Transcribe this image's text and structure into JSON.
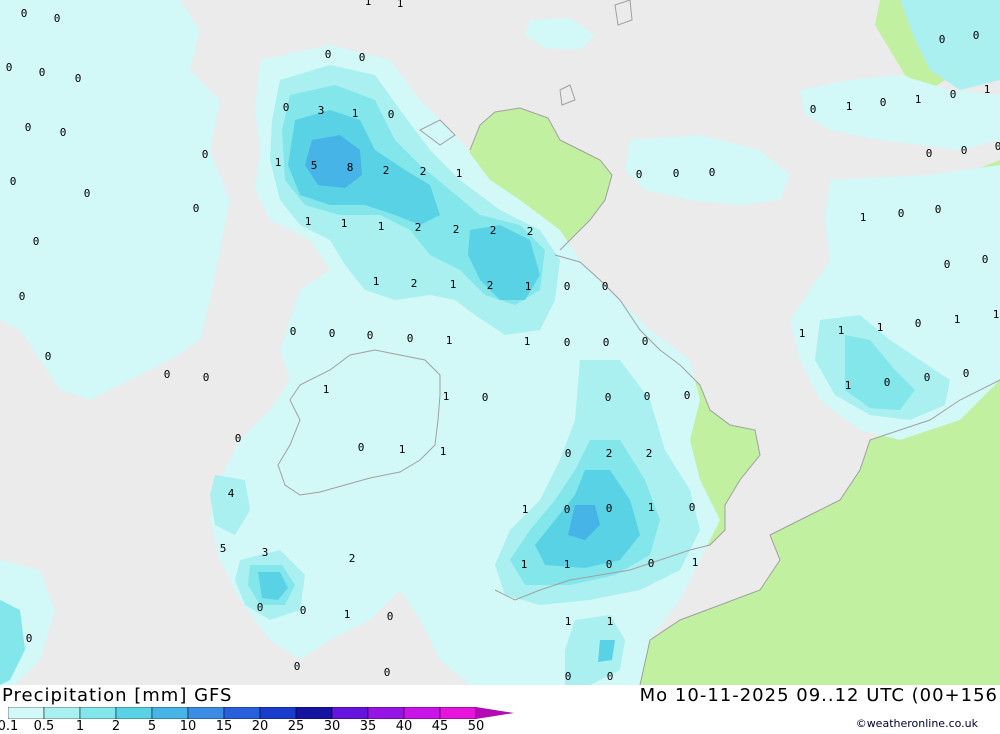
{
  "header": {
    "title_left": "Precipitation [mm] GFS",
    "title_right": "Mo 10-11-2025 09..12 UTC (00+156"
  },
  "credit": "©weatheronline.co.uk",
  "legend": {
    "levels": [
      "0.1",
      "0.5",
      "1",
      "2",
      "5",
      "10",
      "15",
      "20",
      "25",
      "30",
      "35",
      "40",
      "45",
      "50"
    ],
    "colors": [
      "#d2f8f8",
      "#aaf0f0",
      "#82e6ea",
      "#5ad2e6",
      "#46b4e6",
      "#3c8ce6",
      "#2860dc",
      "#1a3ccc",
      "#1414a0",
      "#6414dc",
      "#9614e6",
      "#c814e6",
      "#e614dc",
      "#b40ab4"
    ]
  },
  "palette": {
    "sea": "#ebebeb",
    "land": "#c0f0a0",
    "precip_light": "#d2f8f8",
    "precip_mid": "#aaf0f0",
    "precip_1": "#82e6ea",
    "precip_2": "#5ad2e6",
    "precip_5": "#46b4e6"
  },
  "map_values": [
    {
      "v": "0"
    },
    {
      "v": "0"
    },
    {
      "v": "0"
    },
    {
      "v": "0"
    },
    {
      "v": "0"
    },
    {
      "v": "0"
    },
    {
      "v": "0"
    },
    {
      "v": "0"
    },
    {
      "v": "0"
    },
    {
      "v": "0"
    },
    {
      "v": "0"
    },
    {
      "v": "0"
    },
    {
      "v": "0"
    },
    {
      "v": "0"
    },
    {
      "v": "0"
    },
    {
      "v": "0"
    },
    {
      "v": "0"
    },
    {
      "v": "3"
    },
    {
      "v": "1"
    },
    {
      "v": "0"
    },
    {
      "v": "1"
    },
    {
      "v": "5"
    },
    {
      "v": "8"
    },
    {
      "v": "2"
    },
    {
      "v": "2"
    },
    {
      "v": "1"
    },
    {
      "v": "1"
    },
    {
      "v": "1"
    },
    {
      "v": "1"
    },
    {
      "v": "2"
    },
    {
      "v": "2"
    },
    {
      "v": "2"
    },
    {
      "v": "2"
    },
    {
      "v": "1"
    },
    {
      "v": "2"
    },
    {
      "v": "1"
    },
    {
      "v": "2"
    },
    {
      "v": "1"
    },
    {
      "v": "0"
    },
    {
      "v": "0"
    },
    {
      "v": "0"
    },
    {
      "v": "0"
    },
    {
      "v": "0"
    },
    {
      "v": "0"
    },
    {
      "v": "0"
    },
    {
      "v": "0"
    },
    {
      "v": "0"
    },
    {
      "v": "1"
    },
    {
      "v": "1"
    },
    {
      "v": "0"
    },
    {
      "v": "0"
    },
    {
      "v": "0"
    },
    {
      "v": "0"
    },
    {
      "v": "0"
    },
    {
      "v": "1"
    },
    {
      "v": "1"
    },
    {
      "v": "0"
    },
    {
      "v": "0"
    },
    {
      "v": "0"
    },
    {
      "v": "0"
    },
    {
      "v": "0"
    },
    {
      "v": "0"
    },
    {
      "v": "1"
    },
    {
      "v": "1"
    },
    {
      "v": "0"
    },
    {
      "v": "2"
    },
    {
      "v": "2"
    },
    {
      "v": "4"
    },
    {
      "v": "1"
    },
    {
      "v": "0"
    },
    {
      "v": "0"
    },
    {
      "v": "1"
    },
    {
      "v": "0"
    },
    {
      "v": "5"
    },
    {
      "v": "3"
    },
    {
      "v": "2"
    },
    {
      "v": "1"
    },
    {
      "v": "1"
    },
    {
      "v": "0"
    },
    {
      "v": "0"
    },
    {
      "v": "1"
    },
    {
      "v": "0"
    },
    {
      "v": "0"
    },
    {
      "v": "1"
    },
    {
      "v": "0"
    },
    {
      "v": "1"
    },
    {
      "v": "1"
    },
    {
      "v": "0"
    },
    {
      "v": "0"
    },
    {
      "v": "0"
    },
    {
      "v": "0"
    },
    {
      "v": "0"
    },
    {
      "v": "1"
    },
    {
      "v": "0"
    },
    {
      "v": "1"
    },
    {
      "v": "0"
    },
    {
      "v": "1"
    },
    {
      "v": "0"
    },
    {
      "v": "0"
    },
    {
      "v": "0"
    },
    {
      "v": "0"
    },
    {
      "v": "0"
    },
    {
      "v": "0"
    },
    {
      "v": "1"
    },
    {
      "v": "0"
    },
    {
      "v": "0"
    },
    {
      "v": "0"
    },
    {
      "v": "0"
    },
    {
      "v": "1"
    },
    {
      "v": "1"
    },
    {
      "v": "1"
    },
    {
      "v": "0"
    },
    {
      "v": "1"
    },
    {
      "v": "1"
    },
    {
      "v": "1"
    },
    {
      "v": "0"
    },
    {
      "v": "0"
    },
    {
      "v": "0"
    },
    {
      "v": "0"
    },
    {
      "v": "1"
    },
    {
      "v": "0"
    },
    {
      "v": "1"
    },
    {
      "v": "0"
    }
  ]
}
